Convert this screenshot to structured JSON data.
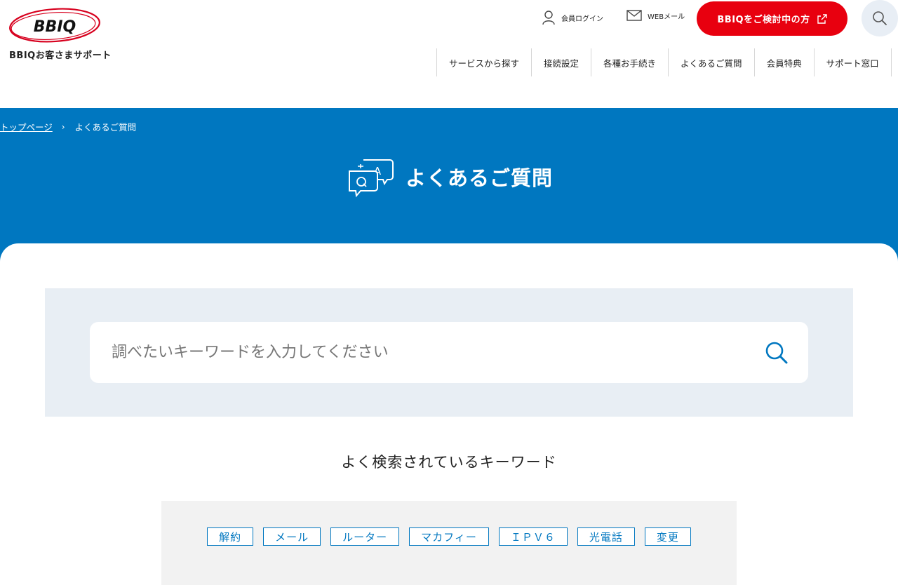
{
  "header": {
    "logo_text": "BBIQ",
    "site_name": "BBIQお客さまサポート",
    "util": {
      "login_label": "会員ログイン",
      "mail_label": "WEBメール"
    },
    "cta_label": "BBIQをご検討中の方",
    "icons": {
      "login": "person-icon",
      "mail": "mail-icon",
      "cta": "external-link-icon",
      "search": "search-icon"
    },
    "nav": [
      {
        "label": "サービスから探す"
      },
      {
        "label": "接続設定"
      },
      {
        "label": "各種お手続き"
      },
      {
        "label": "よくあるご質問"
      },
      {
        "label": "会員特典"
      },
      {
        "label": "サポート窓口"
      }
    ]
  },
  "breadcrumb": {
    "home": "トップページ",
    "separator": "›",
    "current": "よくあるご質問"
  },
  "hero": {
    "title": "よくあるご質問",
    "icon": "qa-chat-icon"
  },
  "search": {
    "placeholder": "調べたいキーワードを入力してください",
    "value": "",
    "icon": "search-icon"
  },
  "keywords": {
    "heading": "よく検索されているキーワード",
    "items": [
      "解約",
      "メール",
      "ルーター",
      "マカフィー",
      "ＩＰＶ６",
      "光電話",
      "変更"
    ]
  },
  "colors": {
    "brand_blue": "#0077c0",
    "cta_red": "#e8000f",
    "panel_gray": "#e8eef4",
    "keyword_panel": "#f2f2f2"
  }
}
